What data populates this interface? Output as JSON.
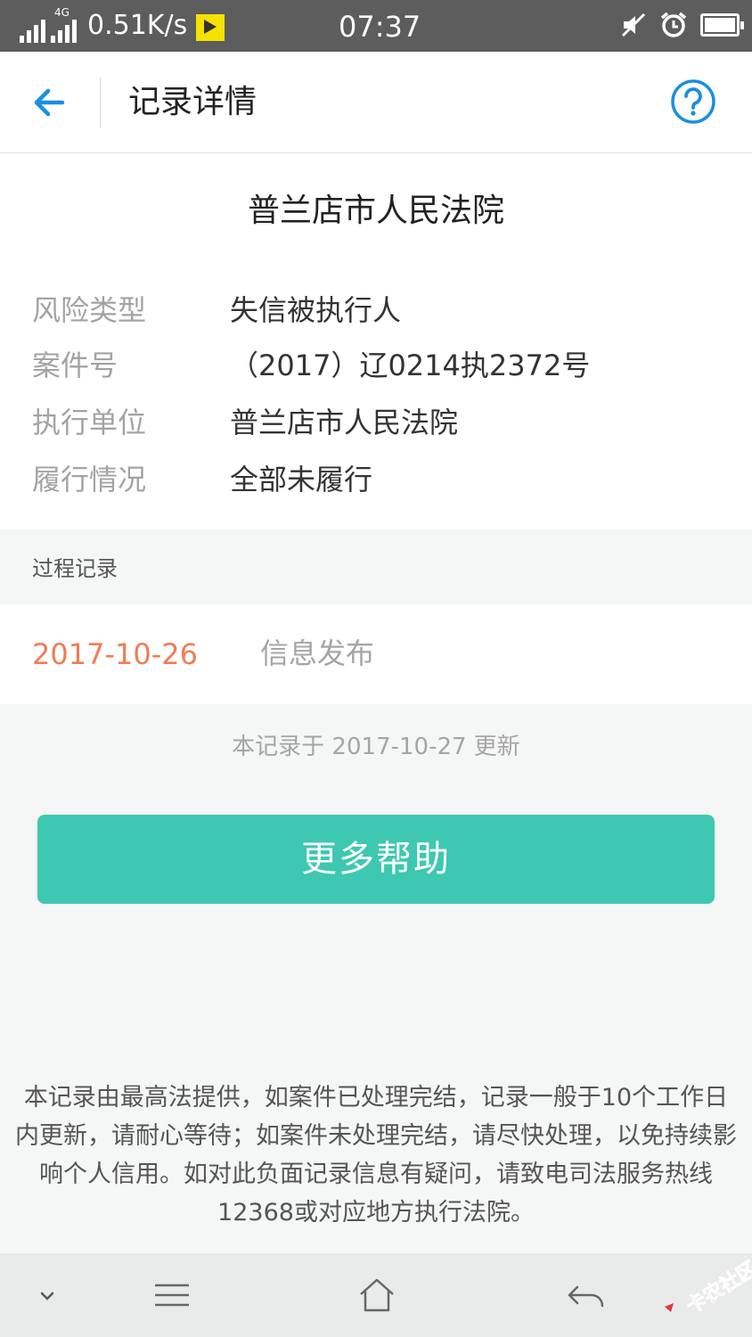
{
  "status_bar": {
    "network_speed": "0.51K/s",
    "network_type": "4G",
    "time": "07:37",
    "icons": [
      "signal-icon",
      "data-icon",
      "flag-icon",
      "mute-icon",
      "alarm-icon",
      "battery-icon"
    ]
  },
  "header": {
    "title": "记录详情",
    "back_icon": "arrow-left-icon",
    "help_icon": "question-circle-icon",
    "accent": "#1a8fe0"
  },
  "court_name": "普兰店市人民法院",
  "details": [
    {
      "label": "风险类型",
      "value": "失信被执行人"
    },
    {
      "label": "案件号",
      "value": "（2017）辽0214执2372号"
    },
    {
      "label": "执行单位",
      "value": "普兰店市人民法院"
    },
    {
      "label": "履行情况",
      "value": "全部未履行"
    }
  ],
  "process_section": {
    "title": "过程记录",
    "records": [
      {
        "date": "2017-10-26",
        "text": "信息发布"
      }
    ],
    "date_color": "#f07c55"
  },
  "updated_note": "本记录于 2017-10-27 更新",
  "help_button": {
    "label": "更多帮助",
    "color": "#3ec8b1"
  },
  "notice": {
    "lines": [
      "本记录由最高法提供，如案件已处理完结，记录一般于10个工作日",
      "内更新，请耐心等待；如案件未处理完结，请尽快处理，以免持续影",
      "响个人信用。如对此负面记录信息有疑问，请致电司法服务热线",
      "12368或对应地方执行法院。"
    ]
  },
  "nav_bar": {
    "icons": [
      "chevron-down-icon",
      "menu-icon",
      "home-icon",
      "back-icon"
    ]
  },
  "watermark": {
    "text": "卡农社区"
  }
}
